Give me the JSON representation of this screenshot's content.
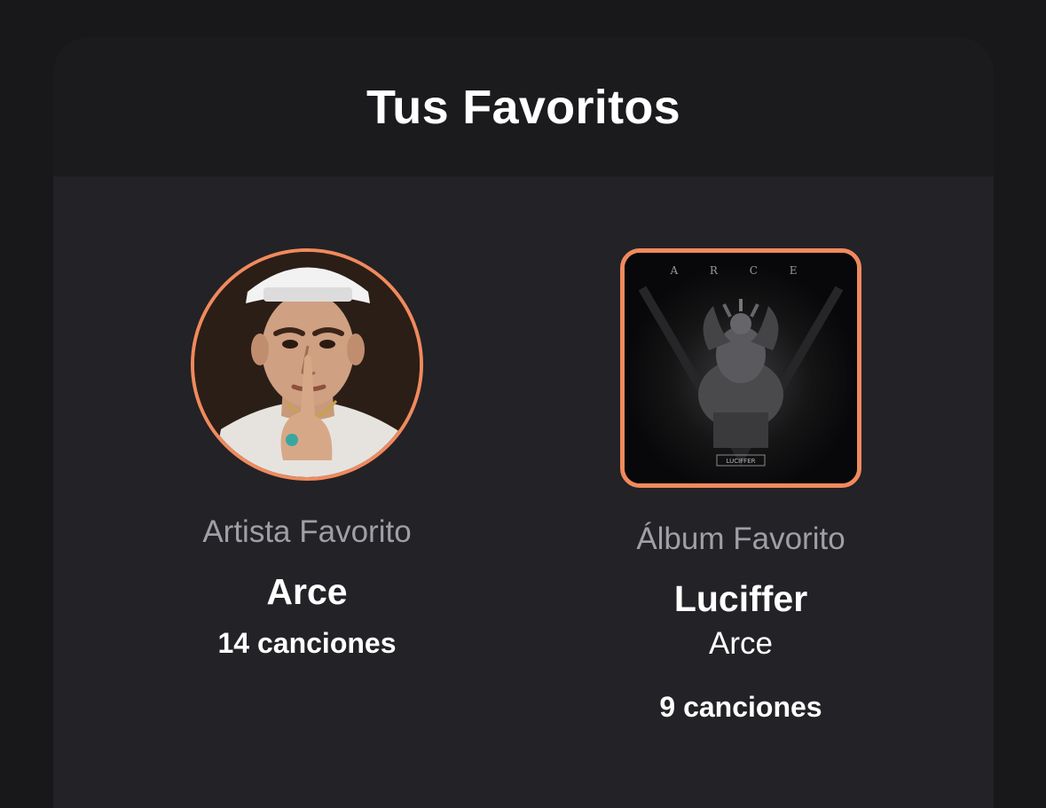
{
  "favorites": {
    "title": "Tus Favoritos",
    "artist": {
      "label": "Artista Favorito",
      "name": "Arce",
      "count": "14 canciones"
    },
    "album": {
      "label": "Álbum Favorito",
      "name": "Luciffer",
      "artist": "Arce",
      "count": "9 canciones",
      "cover_title": "A R C E",
      "cover_caption": "LUCIFFER"
    }
  },
  "colors": {
    "accent_border": "#f08a5d",
    "background": "#18171a",
    "card_body": "#232226",
    "label_gray": "#a09fa5"
  }
}
